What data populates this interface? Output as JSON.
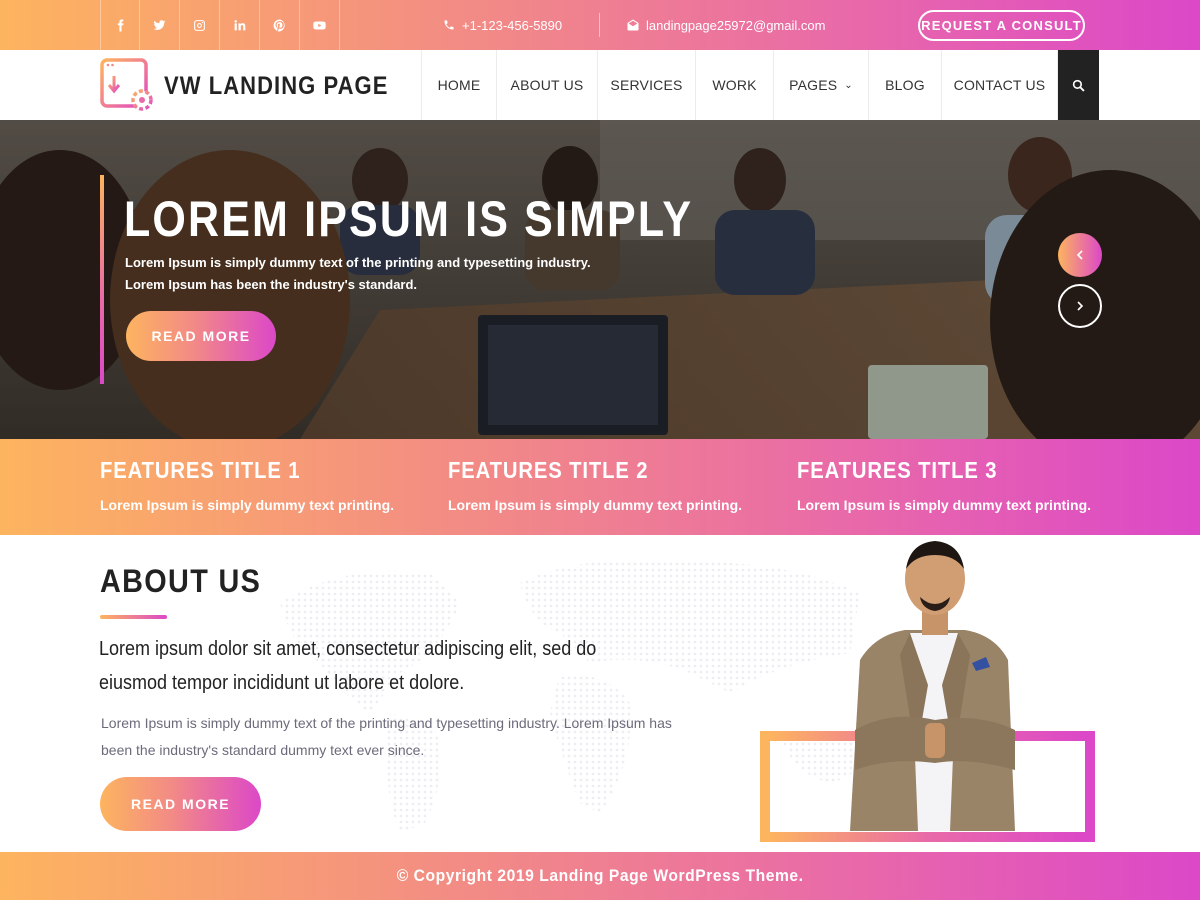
{
  "topbar": {
    "social_icons": [
      "facebook-icon",
      "twitter-icon",
      "instagram-icon",
      "linkedin-icon",
      "pinterest-icon",
      "youtube-icon"
    ],
    "phone": "+1-123-456-5890",
    "email": "landingpage25972@gmail.com",
    "consult_label": "REQUEST A CONSULT"
  },
  "header": {
    "logo_text": "VW LANDING PAGE",
    "nav": [
      {
        "label": "HOME"
      },
      {
        "label": "ABOUT US"
      },
      {
        "label": "SERVICES"
      },
      {
        "label": "WORK"
      },
      {
        "label": "PAGES"
      },
      {
        "label": "BLOG"
      },
      {
        "label": "CONTACT US"
      }
    ]
  },
  "hero": {
    "title": "LOREM IPSUM IS SIMPLY",
    "line1": "Lorem Ipsum is simply dummy text of the printing and typesetting industry.",
    "line2": "Lorem Ipsum has been the industry's standard.",
    "button": "READ MORE"
  },
  "features": [
    {
      "title": "FEATURES TITLE 1",
      "text": "Lorem Ipsum is simply dummy text printing."
    },
    {
      "title": "FEATURES TITLE 2",
      "text": "Lorem Ipsum is simply dummy text printing."
    },
    {
      "title": "FEATURES TITLE 3",
      "text": "Lorem Ipsum is simply dummy text printing."
    }
  ],
  "about": {
    "title": "ABOUT US",
    "lead": "Lorem ipsum dolor sit amet, consectetur adipiscing elit, sed do eiusmod tempor incididunt ut labore et dolore.",
    "body": "Lorem Ipsum is simply dummy text of the printing and typesetting industry. Lorem Ipsum has been the industry's standard dummy text ever since.",
    "button": "READ MORE"
  },
  "footer": {
    "copyright": "© Copyright 2019 Landing Page WordPress Theme."
  },
  "colors": {
    "gradient_start": "#fdb45f",
    "gradient_mid": "#f28a86",
    "gradient_end": "#dc48c8",
    "dark": "#222222"
  }
}
